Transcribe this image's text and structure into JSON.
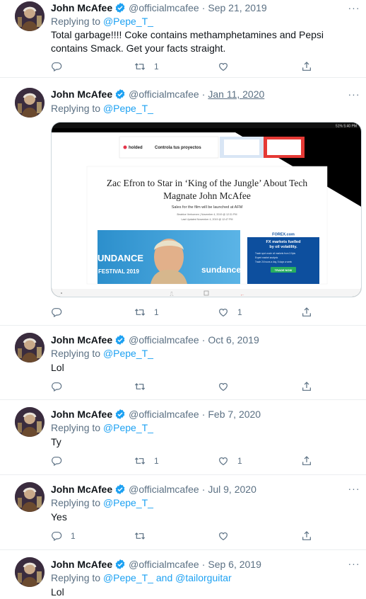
{
  "author": {
    "name": "John McAfee",
    "handle": "@officialmcafee"
  },
  "colors": {
    "accent": "#1da1f2",
    "muted": "#5b7083",
    "text": "#0f1419",
    "border": "#ebeef0"
  },
  "tweets": [
    {
      "date": "Sep 21, 2019",
      "replying_label": "Replying to",
      "replying_to": "@Pepe_T_",
      "text": "Total garbage!!!! Coke contains methamphetamines and Pepsi contains Smack. Get your facts straight.",
      "replies": "",
      "retweets": "1",
      "likes": ""
    },
    {
      "date": "Jan 11, 2020",
      "replying_label": "Replying to",
      "replying_to": "@Pepe_T_",
      "text": "",
      "replies": "",
      "retweets": "1",
      "likes": "1",
      "media": {
        "status_bar": "51% 5:40 PM",
        "ad_brand": "holded",
        "ad_text": "Controla tus proyectos",
        "headline": "Zac Efron to Star in 'King of the Jungle' About Tech Magnate John McAfee",
        "subhead": "Sales for the film will be launched at AFM",
        "byline": "Beatrice Verhoeven | November 4, 2019 @ 12:31 PM",
        "updated": "Last Updated November 4, 2019 @ 12:47 PM",
        "photo_text_1": "UNDANCE",
        "photo_text_2": "FESTIVAL 2019",
        "photo_text_3": "sundance",
        "side_ad_brand": "FOREX.com",
        "side_ad_title": "FX markets fuelled by oil volatility.",
        "side_ad_bullets": [
          "Trade spot crude oil markets from 3.5pts",
          "Expert market analysis",
          "Trade 24 hours a day, 5 days a week"
        ],
        "side_ad_button": "TRADE NOW"
      }
    },
    {
      "date": "Oct 6, 2019",
      "replying_label": "Replying to",
      "replying_to": "@Pepe_T_",
      "text": "Lol",
      "replies": "",
      "retweets": "",
      "likes": ""
    },
    {
      "date": "Feb 7, 2020",
      "replying_label": "Replying to",
      "replying_to": "@Pepe_T_",
      "text": "Ty",
      "replies": "",
      "retweets": "1",
      "likes": "1"
    },
    {
      "date": "Jul 9, 2020",
      "replying_label": "Replying to",
      "replying_to": "@Pepe_T_",
      "text": "Yes",
      "replies": "1",
      "retweets": "",
      "likes": ""
    },
    {
      "date": "Sep 6, 2019",
      "replying_label": "Replying to",
      "replying_to": "@Pepe_T_",
      "replying_and": "and",
      "replying_to_2": "@tailorguitar",
      "text": "Lol"
    }
  ],
  "icons": {
    "reply": "reply-icon",
    "retweet": "retweet-icon",
    "like": "like-icon",
    "share": "share-icon",
    "more": "more-icon",
    "verified": "verified-icon"
  }
}
